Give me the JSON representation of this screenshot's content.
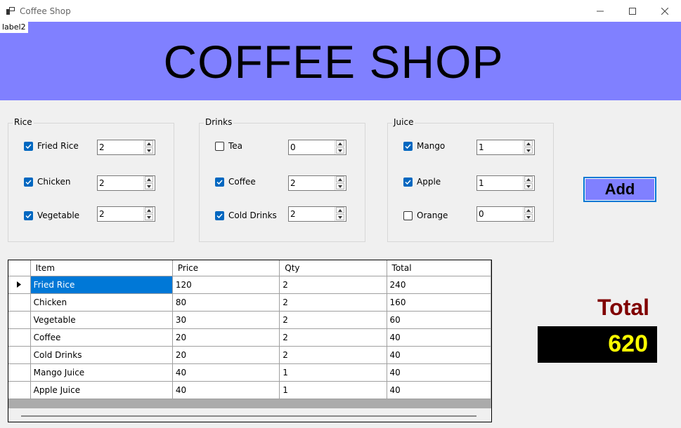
{
  "window": {
    "title": "Coffee Shop"
  },
  "label2": "label2",
  "header": {
    "title": "COFFEE SHOP"
  },
  "groups": [
    {
      "caption": "Rice",
      "items": [
        {
          "label": "Fried Rice",
          "checked": true,
          "qty": "2"
        },
        {
          "label": "Chicken",
          "checked": true,
          "qty": "2"
        },
        {
          "label": "Vegetable",
          "checked": true,
          "qty": "2"
        }
      ]
    },
    {
      "caption": "Drinks",
      "items": [
        {
          "label": "Tea",
          "checked": false,
          "qty": "0"
        },
        {
          "label": "Coffee",
          "checked": true,
          "qty": "2"
        },
        {
          "label": "Cold Drinks",
          "checked": true,
          "qty": "2"
        }
      ]
    },
    {
      "caption": "Juice",
      "items": [
        {
          "label": "Mango",
          "checked": true,
          "qty": "1"
        },
        {
          "label": "Apple",
          "checked": true,
          "qty": "1"
        },
        {
          "label": "Orange",
          "checked": false,
          "qty": "0"
        }
      ]
    }
  ],
  "add_button": "Add",
  "grid": {
    "headers": [
      "Item",
      "Price",
      "Qty",
      "Total"
    ],
    "rows": [
      [
        "Fried Rice",
        "120",
        "2",
        "240"
      ],
      [
        "Chicken",
        "80",
        "2",
        "160"
      ],
      [
        "Vegetable",
        "30",
        "2",
        "60"
      ],
      [
        "Coffee",
        "20",
        "2",
        "40"
      ],
      [
        "Cold Drinks",
        "20",
        "2",
        "40"
      ],
      [
        "Mango Juice",
        "40",
        "1",
        "40"
      ],
      [
        "Apple Juice",
        "40",
        "1",
        "40"
      ]
    ]
  },
  "total": {
    "label": "Total",
    "value": "620"
  },
  "colors": {
    "header_band": "#8080ff",
    "total_label": "#800000",
    "total_value": "#ffff00",
    "checkbox": "#0067c0",
    "selection": "#0078d7"
  }
}
